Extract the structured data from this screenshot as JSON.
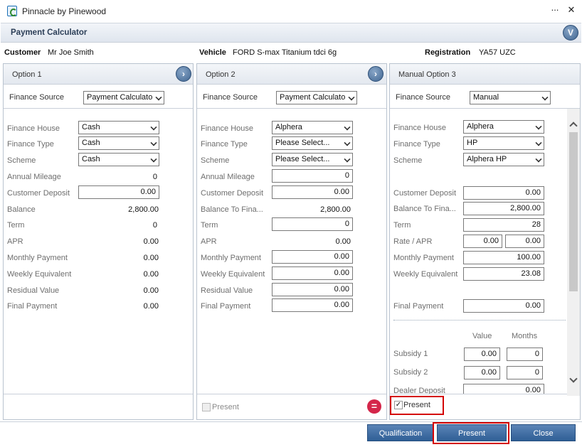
{
  "window": {
    "title": "Pinnacle by Pinewood",
    "minimize": "...",
    "close": "✕"
  },
  "header": {
    "title": "Payment Calculator"
  },
  "info": {
    "customer_label": "Customer",
    "customer": "Mr Joe Smith",
    "vehicle_label": "Vehicle",
    "vehicle": "FORD S-max Titanium tdci 6g",
    "registration_label": "Registration",
    "registration": "YA57 UZC"
  },
  "opt1": {
    "title": "Option 1",
    "fs_label": "Finance Source",
    "fs_value": "Payment Calculato",
    "fh_label": "Finance House",
    "fh": "Cash",
    "ft_label": "Finance Type",
    "ft": "Cash",
    "sc_label": "Scheme",
    "sc": "Cash",
    "am_label": "Annual Mileage",
    "am": "0",
    "cd_label": "Customer Deposit",
    "cd": "0.00",
    "bal_label": "Balance",
    "bal": "2,800.00",
    "term_label": "Term",
    "term": "0",
    "apr_label": "APR",
    "apr": "0.00",
    "mp_label": "Monthly Payment",
    "mp": "0.00",
    "we_label": "Weekly Equivalent",
    "we": "0.00",
    "rv_label": "Residual Value",
    "rv": "0.00",
    "fp_label": "Final Payment",
    "fp": "0.00"
  },
  "opt2": {
    "title": "Option 2",
    "fs_label": "Finance Source",
    "fs_value": "Payment Calculato",
    "fh_label": "Finance House",
    "fh": "Alphera",
    "ft_label": "Finance Type",
    "ft": "Please Select...",
    "sc_label": "Scheme",
    "sc": "Please Select...",
    "am_label": "Annual Mileage",
    "am": "0",
    "cd_label": "Customer Deposit",
    "cd": "0.00",
    "bal_label": "Balance To Fina...",
    "bal": "2,800.00",
    "term_label": "Term",
    "term": "0",
    "apr_label": "APR",
    "apr": "0.00",
    "mp_label": "Monthly Payment",
    "mp": "0.00",
    "we_label": "Weekly Equivalent",
    "we": "0.00",
    "rv_label": "Residual Value",
    "rv": "0.00",
    "fp_label": "Final Payment",
    "fp": "0.00",
    "present": "Present"
  },
  "opt3": {
    "title": "Manual Option 3",
    "fs_label": "Finance Source",
    "fs_value": "Manual",
    "fh_label": "Finance House",
    "fh": "Alphera",
    "ft_label": "Finance Type",
    "ft": "HP",
    "sc_label": "Scheme",
    "sc": "Alphera HP",
    "cd_label": "Customer Deposit",
    "cd": "0.00",
    "bal_label": "Balance To Fina...",
    "bal": "2,800.00",
    "term_label": "Term",
    "term": "28",
    "rate_label": "Rate / APR",
    "rate": "0.00",
    "apr": "0.00",
    "mp_label": "Monthly Payment",
    "mp": "100.00",
    "we_label": "Weekly Equivalent",
    "we": "23.08",
    "fp_label": "Final Payment",
    "fp": "0.00",
    "value_hdr": "Value",
    "months_hdr": "Months",
    "s1_label": "Subsidy 1",
    "s1_val": "0.00",
    "s1_months": "0",
    "s2_label": "Subsidy 2",
    "s2_val": "0.00",
    "s2_months": "0",
    "dd_label": "Dealer Deposit",
    "dd": "0.00",
    "present": "Present"
  },
  "buttons": {
    "qualification": "Qualification",
    "present": "Present",
    "close": "Close"
  },
  "colors": {
    "highlight": "#d40000",
    "button": "#3a6aa3"
  }
}
